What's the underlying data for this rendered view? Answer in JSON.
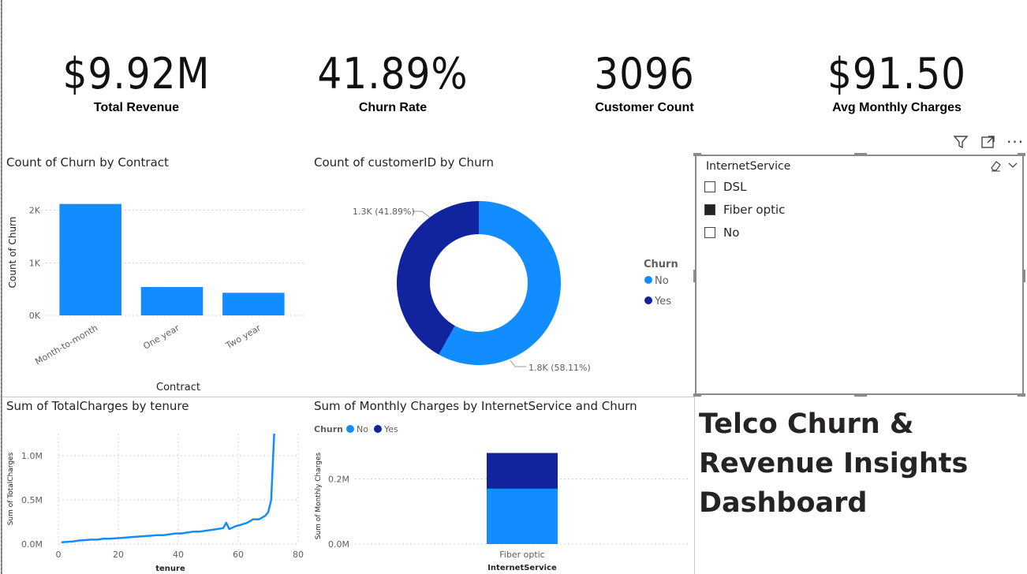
{
  "kpis": [
    {
      "value": "$9.92M",
      "label": "Total Revenue"
    },
    {
      "value": "41.89%",
      "label": "Churn Rate"
    },
    {
      "value": "3096",
      "label": "Customer Count"
    },
    {
      "value": "$91.50",
      "label": "Avg Monthly Charges"
    }
  ],
  "toolbar": {
    "filter_icon": "filter-icon",
    "focus_icon": "focus-mode-icon",
    "more_icon": "more-options-icon"
  },
  "slicer": {
    "title": "InternetService",
    "items": [
      {
        "label": "DSL",
        "checked": false
      },
      {
        "label": "Fiber optic",
        "checked": true
      },
      {
        "label": "No",
        "checked": false
      }
    ]
  },
  "dashboard_title_lines": [
    "Telco Churn &",
    "Revenue Insights",
    "Dashboard"
  ],
  "colors": {
    "light_blue": "#118DFF",
    "dark_blue": "#12239E",
    "grid": "#d0d0d0"
  },
  "chart_data": [
    {
      "type": "bar",
      "title": "Count of Churn by Contract",
      "xlabel": "Contract",
      "ylabel": "Count of Churn",
      "categories": [
        "Month-to-month",
        "One year",
        "Two year"
      ],
      "values": [
        2120,
        540,
        430
      ],
      "yticks": [
        "0K",
        "1K",
        "2K"
      ],
      "ylim": [
        0,
        2400
      ]
    },
    {
      "type": "pie",
      "title": "Count of customerID by Churn",
      "legend_title": "Churn",
      "series": [
        {
          "name": "No",
          "value": 1799,
          "label": "1.8K (58.11%)"
        },
        {
          "name": "Yes",
          "value": 1297,
          "label": "1.3K (41.89%)"
        }
      ]
    },
    {
      "type": "line",
      "title": "Sum of TotalCharges by tenure",
      "xlabel": "tenure",
      "ylabel": "Sum of TotalCharges",
      "xticks": [
        "0",
        "20",
        "40",
        "60",
        "80"
      ],
      "yticks": [
        "0.0M",
        "0.5M",
        "1.0M"
      ],
      "xlim": [
        0,
        80
      ],
      "ylim": [
        0,
        1.25
      ],
      "x": [
        1,
        3,
        5,
        7,
        9,
        11,
        13,
        15,
        17,
        19,
        21,
        23,
        25,
        27,
        29,
        31,
        33,
        35,
        37,
        39,
        41,
        43,
        45,
        47,
        49,
        51,
        53,
        55,
        56,
        57,
        59,
        61,
        63,
        65,
        67,
        69,
        70,
        71,
        72
      ],
      "y": [
        0.02,
        0.025,
        0.03,
        0.04,
        0.045,
        0.05,
        0.05,
        0.06,
        0.06,
        0.065,
        0.07,
        0.075,
        0.08,
        0.085,
        0.09,
        0.095,
        0.1,
        0.1,
        0.11,
        0.12,
        0.12,
        0.13,
        0.14,
        0.14,
        0.15,
        0.16,
        0.17,
        0.18,
        0.24,
        0.17,
        0.2,
        0.22,
        0.24,
        0.28,
        0.28,
        0.32,
        0.36,
        0.5,
        1.25
      ]
    },
    {
      "type": "bar",
      "title": "Sum of Monthly Charges by InternetService and Churn",
      "xlabel": "InternetService",
      "ylabel": "Sum of Monthly Charges",
      "legend_title": "Churn",
      "categories": [
        "Fiber optic"
      ],
      "series": [
        {
          "name": "No",
          "values": [
            0.17
          ]
        },
        {
          "name": "Yes",
          "values": [
            0.11
          ]
        }
      ],
      "yticks": [
        "0.0M",
        "0.2M"
      ],
      "ylim": [
        0,
        0.32
      ]
    }
  ]
}
